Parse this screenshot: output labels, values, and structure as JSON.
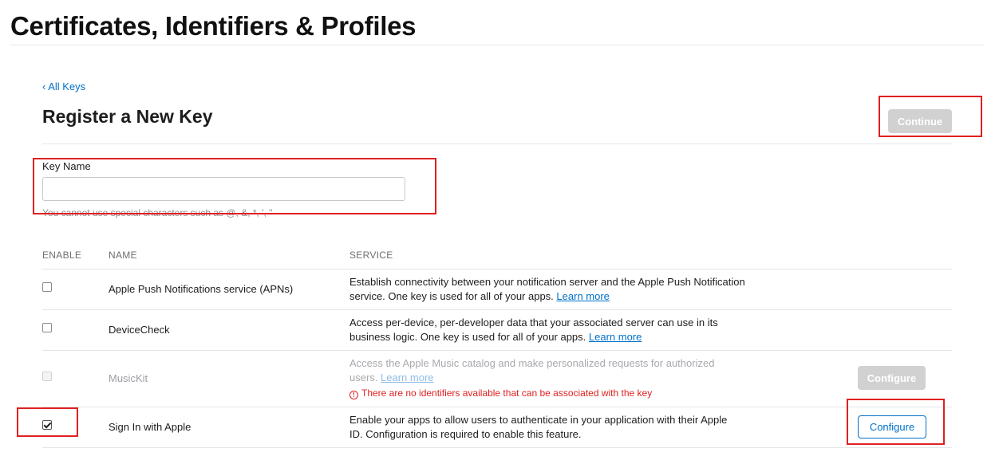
{
  "page": {
    "title": "Certificates, Identifiers & Profiles"
  },
  "nav": {
    "back_label": "‹ All Keys"
  },
  "form": {
    "heading": "Register a New Key",
    "continue_label": "Continue",
    "key_name_label": "Key Name",
    "key_name_value": "",
    "key_name_hint": "You cannot use special characters such as @, &, *, ', \""
  },
  "table": {
    "headers": {
      "enable": "ENABLE",
      "name": "NAME",
      "service": "SERVICE"
    },
    "rows": [
      {
        "checked": false,
        "enabled": true,
        "name": "Apple Push Notifications service (APNs)",
        "description": "Establish connectivity between your notification server and the Apple Push Notification service. One key is used for all of your apps.",
        "link": "Learn more"
      },
      {
        "checked": false,
        "enabled": true,
        "name": "DeviceCheck",
        "description": "Access per-device, per-developer data that your associated server can use in its business logic. One key is used for all of your apps.",
        "link": "Learn more"
      },
      {
        "checked": false,
        "enabled": false,
        "name": "MusicKit",
        "description": "Access the Apple Music catalog and make personalized requests for authorized users.",
        "link": "Learn more",
        "warning": "There are no identifiers available that can be associated with the key",
        "action_label": "Configure",
        "action_enabled": false
      },
      {
        "checked": true,
        "enabled": true,
        "name": "Sign In with Apple",
        "description": "Enable your apps to allow users to authenticate in your application with their Apple ID. Configuration is required to enable this feature.",
        "action_label": "Configure",
        "action_enabled": true
      }
    ]
  },
  "colors": {
    "accent": "#0070c9",
    "highlight": "#e02020",
    "disabled_button": "#d1d1d1"
  }
}
